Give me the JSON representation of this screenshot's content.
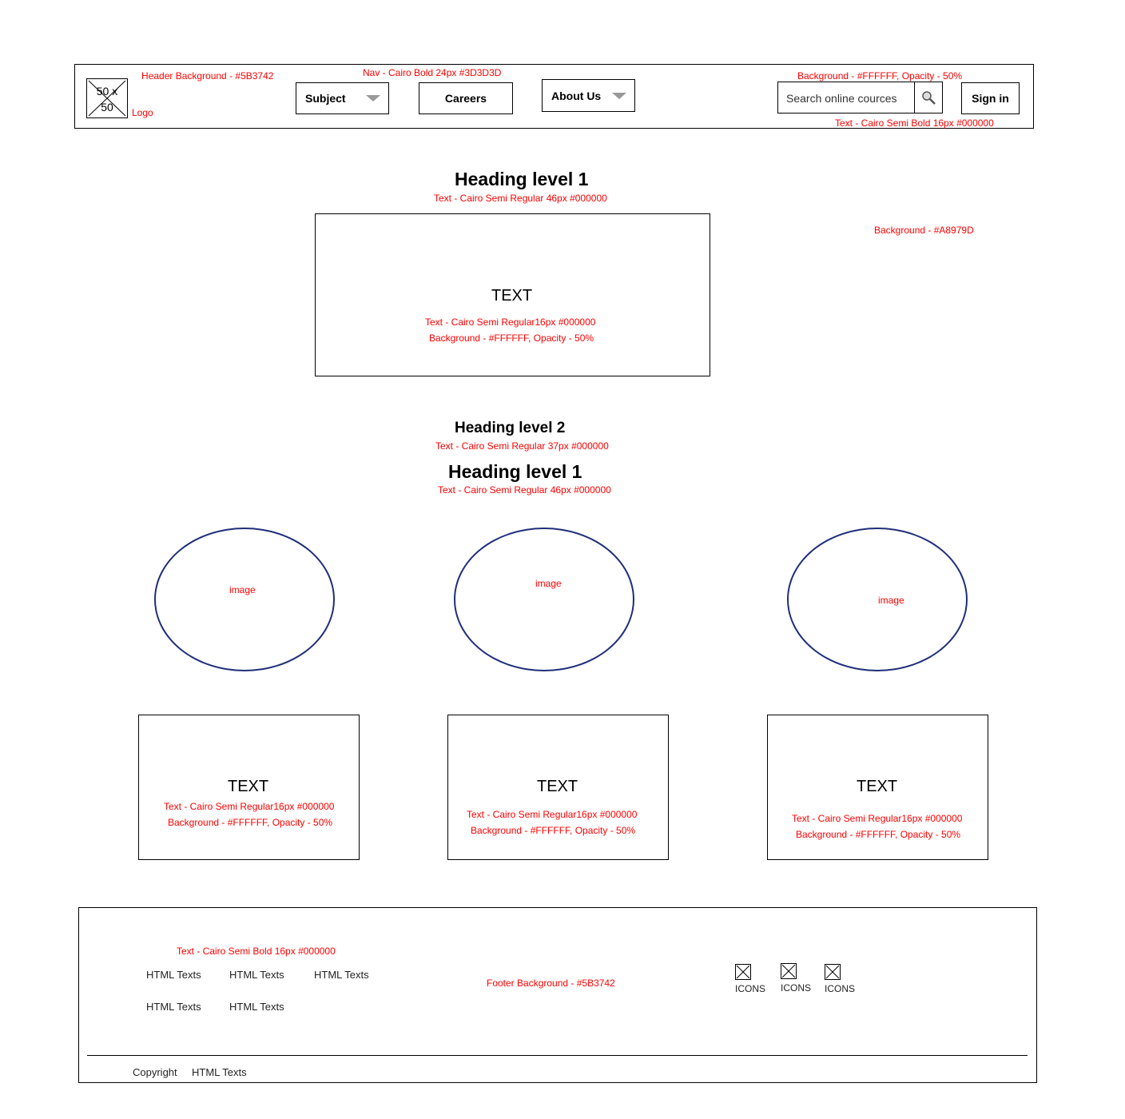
{
  "header": {
    "logo_text": "50 x 50",
    "logo_label": "Logo",
    "bg_note": "Header Background - #5B3742",
    "nav_note": "Nav - Cairo Bold 24px #3D3D3D",
    "search_bg_note": "Background - #FFFFFF, Opacity - 50%",
    "search_text_note": "Text - Cairo Semi Bold 16px #000000",
    "nav": {
      "subject": "Subject",
      "careers": "Careers",
      "about": "About Us"
    },
    "search_placeholder": "Search online cources",
    "signin": "Sign in"
  },
  "page_bg_note": "Background - #A8979D",
  "hero": {
    "heading": "Heading level 1",
    "heading_note": "Text - Cairo Semi Regular 46px #000000",
    "box_title": "TEXT",
    "box_note1": "Text - Cairo Semi Regular16px #000000",
    "box_note2": "Background - #FFFFFF, Opacity - 50%"
  },
  "section": {
    "h2": "Heading level 2",
    "h2_note": "Text - Cairo Semi Regular 37px #000000",
    "h1": "Heading level 1",
    "h1_note": "Text - Cairo Semi Regular 46px #000000"
  },
  "images": [
    "image",
    "image",
    "image"
  ],
  "cards": [
    {
      "title": "TEXT",
      "note1": "Text - Cairo Semi Regular16px #000000",
      "note2": "Background - #FFFFFF, Opacity - 50%"
    },
    {
      "title": "TEXT",
      "note1": "Text - Cairo Semi Regular16px #000000",
      "note2": "Background - #FFFFFF, Opacity - 50%"
    },
    {
      "title": "TEXT",
      "note1": "Text - Cairo Semi Regular16px #000000",
      "note2": "Background - #FFFFFF, Opacity - 50%"
    }
  ],
  "footer": {
    "text_note": "Text - Cairo Semi Bold 16px #000000",
    "bg_note": "Footer Background - #5B3742",
    "links": [
      "HTML Texts",
      "HTML Texts",
      "HTML Texts",
      "HTML Texts",
      "HTML Texts"
    ],
    "icons": [
      "ICONS",
      "ICONS",
      "ICONS"
    ],
    "copyright": "Copyright",
    "copyright_text": "HTML Texts"
  }
}
